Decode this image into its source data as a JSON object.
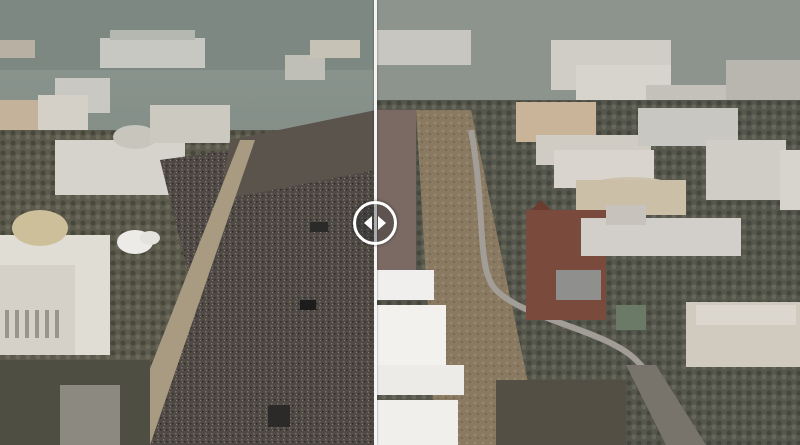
{
  "viewer": {
    "type": "before-after-comparison",
    "split_fraction": 0.47,
    "left_image": {
      "icon": "aerial-crowd-photo"
    },
    "right_image": {
      "icon": "aerial-sparse-photo"
    },
    "handle_icon": "arrows-left-right-icon"
  },
  "colors": {
    "divider": "#f4f4f4",
    "handle_border": "#ffffff"
  }
}
